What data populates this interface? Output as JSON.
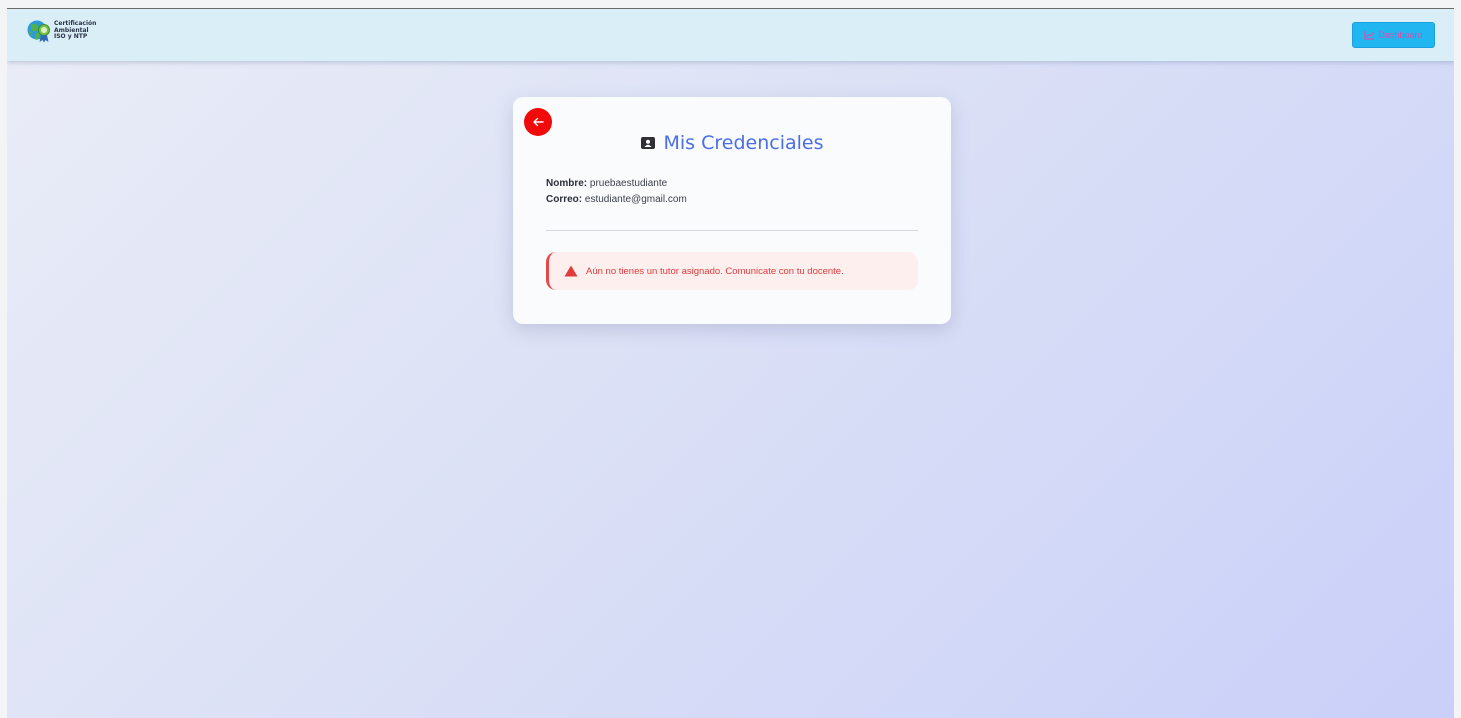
{
  "navbar": {
    "logo": {
      "line1": "Certificación",
      "line2": "Ambiental",
      "line3": "ISO y NTP",
      "icon": "globe-leaf-badge-icon"
    },
    "dashboard_button": {
      "label": "Dashboard",
      "icon": "chart-line-icon"
    }
  },
  "card": {
    "back_icon": "arrow-left-icon",
    "title_icon": "id-card-icon",
    "title": "Mis Credenciales",
    "fields": [
      {
        "label": "Nombre:",
        "value": "pruebaestudiante"
      },
      {
        "label": "Correo:",
        "value": "estudiante@gmail.com"
      }
    ],
    "alert": {
      "icon": "warning-triangle-icon",
      "text": "Aún no tienes un tutor asignado. Comunicate con tu docente."
    }
  },
  "colors": {
    "navbar_bg": "#daeef8",
    "button_bg": "#22b6f0",
    "button_text": "#d94fae",
    "title": "#4a6ee8",
    "back_button": "#f00a0a",
    "alert_bg": "#fcefee",
    "alert_text": "#e23b3b"
  }
}
